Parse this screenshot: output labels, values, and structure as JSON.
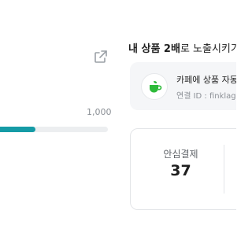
{
  "progress": {
    "max_label": "1,000",
    "fill_fraction": 0.33,
    "fill_color": "#159ba6"
  },
  "external_link": {
    "icon": "external-link-icon"
  },
  "section": {
    "title_bold_1": "내 상품 2배",
    "title_rest": "로 노출시키기"
  },
  "cafe": {
    "icon": "coffee-cup-icon",
    "icon_color": "#2dba3a",
    "name": "카페에 상품 자동 등록",
    "connected_id": "연결 ID : finklagl@"
  },
  "stats": {
    "label": "안심결제",
    "value": "37"
  }
}
